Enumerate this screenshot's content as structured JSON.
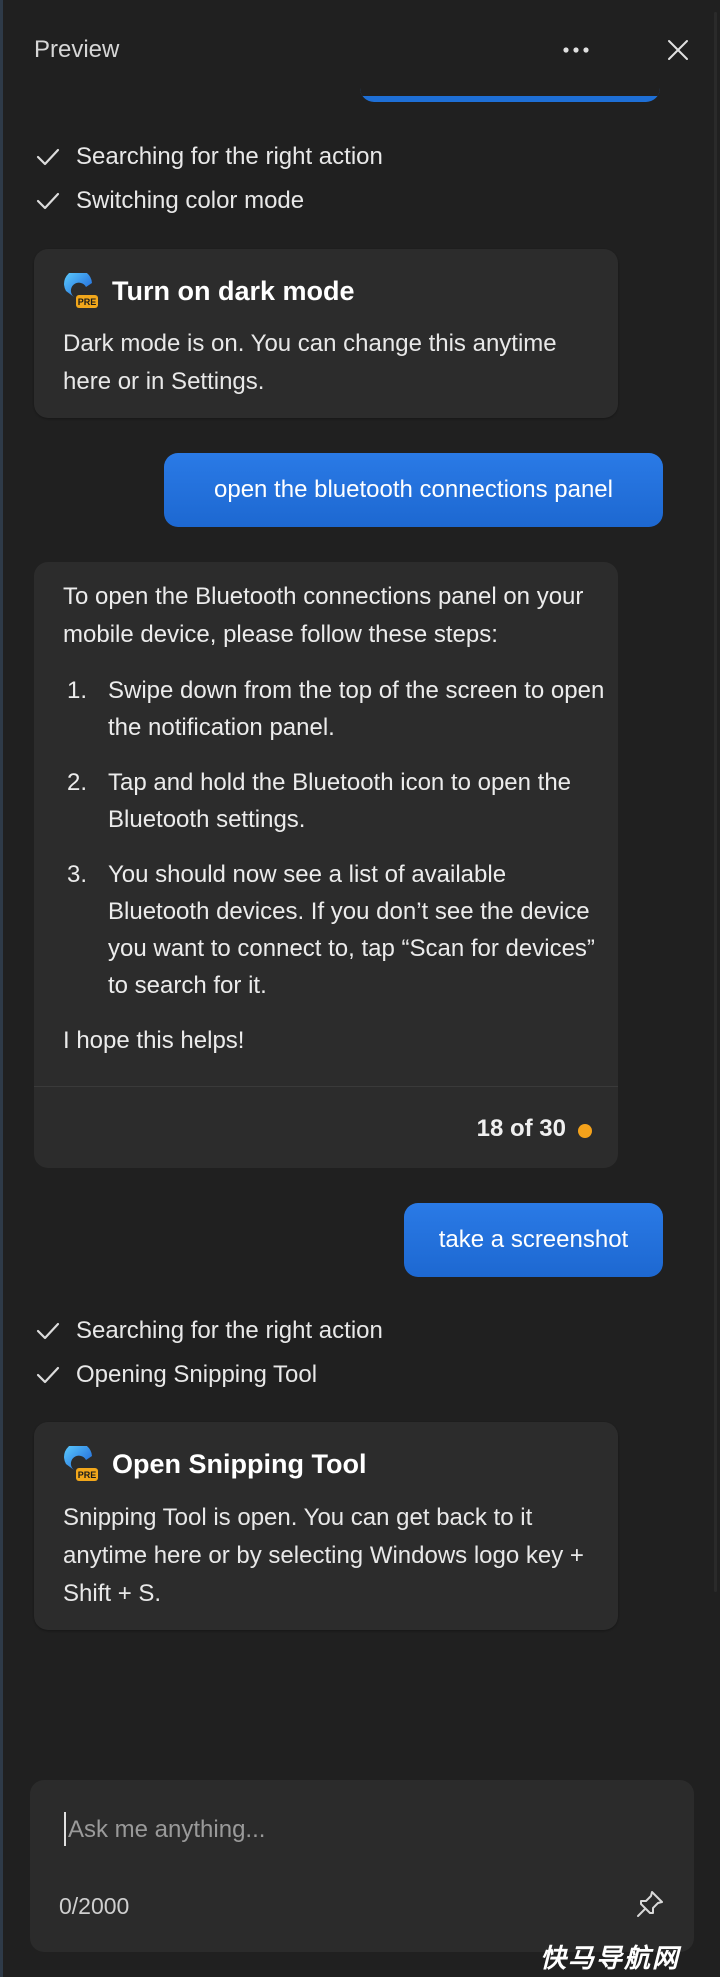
{
  "window": {
    "title": "Preview",
    "more_icon": "more-horizontal-icon",
    "close_icon": "close-icon"
  },
  "steps_group_1": [
    {
      "label": "Searching for the right action",
      "icon": "check-icon"
    },
    {
      "label": "Switching color mode",
      "icon": "check-icon"
    }
  ],
  "card_dark_mode": {
    "icon": "copilot-pre-icon",
    "icon_badge": "PRE",
    "title": "Turn on dark mode",
    "body": "Dark mode is on. You can change this anytime here or in Settings."
  },
  "user_message_1": "open the bluetooth connections panel",
  "answer": {
    "intro": "To open the Bluetooth connections panel on your mobile device, please follow these steps:",
    "steps": [
      {
        "num": "1.",
        "text": "Swipe down from the top of the screen to open the notification panel."
      },
      {
        "num": "2.",
        "text": "Tap and hold the Bluetooth icon to open the Bluetooth settings."
      },
      {
        "num": "3.",
        "text": "You should now see a list of available Bluetooth devices. If you don’t see the device you want to connect to, tap “Scan for devices” to search for it."
      }
    ],
    "outro": "I hope this helps!",
    "counter": "18 of 30",
    "counter_dot_color": "#f4a21b"
  },
  "user_message_2": "take a screenshot",
  "steps_group_2": [
    {
      "label": "Searching for the right action",
      "icon": "check-icon"
    },
    {
      "label": "Opening Snipping Tool",
      "icon": "check-icon"
    }
  ],
  "card_snipping": {
    "icon": "copilot-pre-icon",
    "icon_badge": "PRE",
    "title": "Open Snipping Tool",
    "body": "Snipping Tool is open. You can get back to it anytime here or by selecting Windows logo key + Shift + S."
  },
  "composer": {
    "placeholder": "Ask me anything...",
    "char_count": "0/2000",
    "pin_icon": "pin-icon"
  },
  "watermark": "快马导航网",
  "colors": {
    "background": "#202020",
    "card": "#2c2c2c",
    "accent": "#1d68d1"
  }
}
